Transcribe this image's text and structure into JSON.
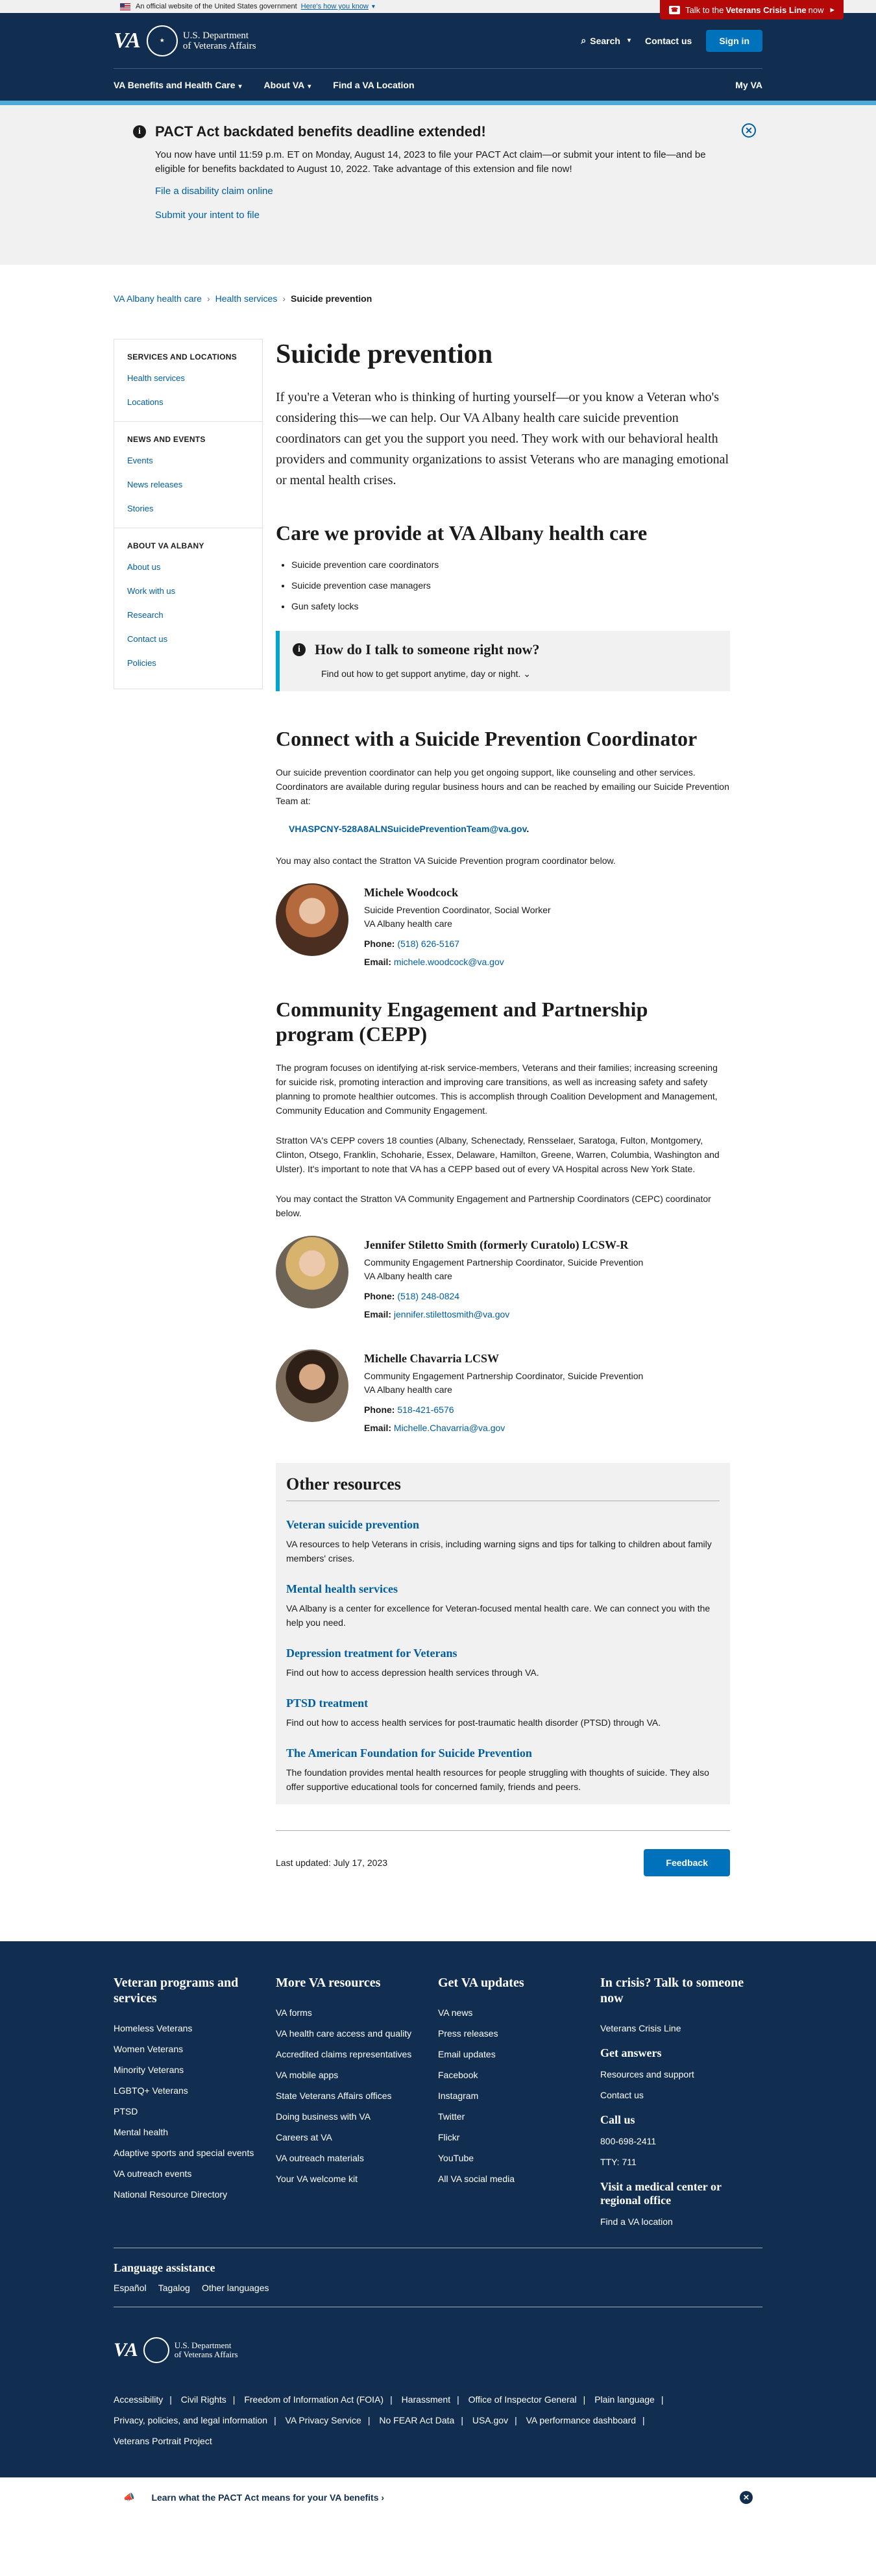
{
  "official": {
    "text": "An official website of the United States government",
    "link": "Here's how you know",
    "crisis_prefix": "Talk to the",
    "crisis_bold": "Veterans Crisis Line",
    "crisis_suffix": "now"
  },
  "header": {
    "logo_va": "VA",
    "dept_line1": "U.S. Department",
    "dept_line2": "of Veterans Affairs",
    "search": "Search",
    "contact": "Contact us",
    "signin": "Sign in",
    "nav": [
      "VA Benefits and Health Care",
      "About VA",
      "Find a VA Location"
    ],
    "myva": "My VA"
  },
  "alert": {
    "title": "PACT Act backdated benefits deadline extended!",
    "body": "You now have until 11:59 p.m. ET on Monday, August 14, 2023 to file your PACT Act claim—or submit your intent to file—and be eligible for benefits backdated to August 10, 2022. Take advantage of this extension and file now!",
    "link1": "File a disability claim online",
    "link2": "Submit your intent to file"
  },
  "breadcrumb": [
    "VA Albany health care",
    "Health services",
    "Suicide prevention"
  ],
  "sidenav": {
    "sections": [
      {
        "title": "SERVICES AND LOCATIONS",
        "items": [
          "Health services",
          "Locations"
        ]
      },
      {
        "title": "NEWS AND EVENTS",
        "items": [
          "Events",
          "News releases",
          "Stories"
        ]
      },
      {
        "title": "ABOUT VA ALBANY",
        "items": [
          "About us",
          "Work with us",
          "Research",
          "Contact us",
          "Policies"
        ]
      }
    ]
  },
  "page": {
    "title": "Suicide prevention",
    "lead": "If you're a Veteran who is thinking of hurting yourself—or you know a Veteran who's considering this—we can help. Our VA Albany health care suicide prevention coordinators can get you the support you need. They work with our behavioral health providers and community organizations to assist Veterans who are managing emotional or mental health crises.",
    "care_title": "Care we provide at VA Albany health care",
    "care_items": [
      "Suicide prevention care coordinators",
      "Suicide prevention case managers",
      "Gun safety locks"
    ],
    "talk_title": "How do I talk to someone right now?",
    "talk_link": "Find out how to get support anytime, day or night.",
    "connect_title": "Connect with a Suicide Prevention Coordinator",
    "connect_body": "Our suicide prevention coordinator can help you get ongoing support, like counseling and other services. Coordinators are available during regular business hours and can be reached by emailing our Suicide Prevention Team at:",
    "connect_email": "VHASPCNY-528A8ALNSuicidePreventionTeam@va.gov",
    "connect_after": ".",
    "connect_also": "You may also contact the Stratton VA Suicide Prevention program coordinator below.",
    "cepp_title": "Community Engagement and Partnership program (CEPP)",
    "cepp_p1": "The program focuses on identifying at-risk service-members, Veterans and their families; increasing screening for suicide risk, promoting interaction and improving care transitions, as well as increasing safety and safety planning to promote healthier outcomes.  This is accomplish through Coalition Development and Management, Community Education and Community Engagement.",
    "cepp_p2": "Stratton VA's CEPP  covers 18 counties (Albany, Schenectady, Rensselaer, Saratoga, Fulton, Montgomery, Clinton, Otsego, Franklin, Schoharie, Essex, Delaware, Hamilton, Greene, Warren, Columbia, Washington and Ulster).  It's important to note that VA has a CEPP based out of every VA Hospital across New York State.",
    "cepp_p3": "You may contact the Stratton VA Community Engagement and Partnership Coordinators (CEPC) coordinator below.",
    "phone_label": "Phone:",
    "email_label": "Email:",
    "people": [
      {
        "name": "Michele Woodcock",
        "role": "Suicide Prevention Coordinator, Social Worker",
        "org": "VA Albany health care",
        "phone": "(518) 626-5167",
        "email": "michele.woodcock@va.gov"
      },
      {
        "name": "Jennifer Stiletto Smith (formerly Curatolo) LCSW-R",
        "role": "Community Engagement Partnership Coordinator, Suicide Prevention",
        "org": "VA Albany health care",
        "phone": "(518) 248-0824",
        "email": "jennifer.stilettosmith@va.gov"
      },
      {
        "name": "Michelle Chavarria LCSW",
        "role": "Community Engagement Partnership Coordinator, Suicide Prevention",
        "org": "VA Albany health care",
        "phone": "518-421-6576",
        "email": "Michelle.Chavarria@va.gov"
      }
    ],
    "other_title": "Other resources",
    "other": [
      {
        "title": "Veteran suicide prevention",
        "desc": "VA resources to help Veterans in crisis, including warning signs and tips for talking to children about family members' crises."
      },
      {
        "title": "Mental health services",
        "desc": "VA Albany is a center for excellence for Veteran-focused mental health care. We can connect you with the help you need."
      },
      {
        "title": "Depression treatment for Veterans",
        "desc": "Find out how to access depression health services through VA."
      },
      {
        "title": "PTSD treatment",
        "desc": "Find out how to access health services for post-traumatic health disorder (PTSD) through VA."
      },
      {
        "title": "The American Foundation for Suicide Prevention",
        "desc": "The foundation provides mental health resources for people struggling with thoughts of suicide. They also offer supportive educational tools for concerned family, friends and peers."
      }
    ],
    "updated": "Last updated: July 17, 2023",
    "feedback": "Feedback"
  },
  "footer": {
    "col1": {
      "title": "Veteran programs and services",
      "links": [
        "Homeless Veterans",
        "Women Veterans",
        "Minority Veterans",
        "LGBTQ+ Veterans",
        "PTSD",
        "Mental health",
        "Adaptive sports and special events",
        "VA outreach events",
        "National Resource Directory"
      ]
    },
    "col2": {
      "title": "More VA resources",
      "links": [
        "VA forms",
        "VA health care access and quality",
        "Accredited claims representatives",
        "VA mobile apps",
        "State Veterans Affairs offices",
        "Doing business with VA",
        "Careers at VA",
        "VA outreach materials",
        "Your VA welcome kit"
      ]
    },
    "col3": {
      "title": "Get VA updates",
      "links": [
        "VA news",
        "Press releases",
        "Email updates",
        "Facebook",
        "Instagram",
        "Twitter",
        "Flickr",
        "YouTube",
        "All VA social media"
      ]
    },
    "col4": {
      "title": "In crisis? Talk to someone now",
      "crisis_link": "Veterans Crisis Line",
      "answers_title": "Get answers",
      "answers_links": [
        "Resources and support",
        "Contact us"
      ],
      "call_title": "Call us",
      "call_links": [
        "800-698-2411",
        "TTY: 711"
      ],
      "visit_title": "Visit a medical center or regional office",
      "visit_link": "Find a VA location"
    },
    "lang_title": "Language assistance",
    "langs": [
      "Español",
      "Tagalog",
      "Other languages"
    ],
    "logo_va": "VA",
    "dept_line1": "U.S. Department",
    "dept_line2": "of Veterans Affairs",
    "bottom_row1": [
      "Accessibility",
      "Civil Rights",
      "Freedom of Information Act (FOIA)",
      "Harassment",
      "Office of Inspector General",
      "Plain language"
    ],
    "bottom_row2": [
      "Privacy, policies, and legal information",
      "VA Privacy Service",
      "No FEAR Act Data",
      "USA.gov",
      "VA performance dashboard"
    ],
    "bottom_row3": [
      "Veterans Portrait Project"
    ]
  },
  "bottom_bar": {
    "text": "Learn what the PACT Act means for your VA benefits"
  }
}
